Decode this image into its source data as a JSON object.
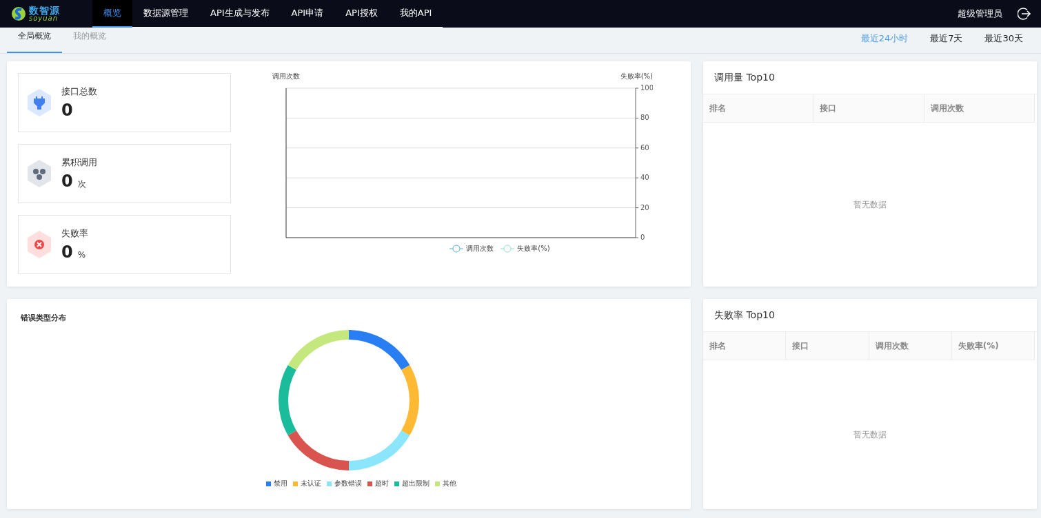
{
  "logo": {
    "name": "数智源",
    "sub": "soyuan"
  },
  "nav": [
    {
      "label": "概览",
      "selected": true
    },
    {
      "label": "数据源管理",
      "selected": false
    },
    {
      "label": "API生成与发布",
      "selected": false
    },
    {
      "label": "API申请",
      "selected": false
    },
    {
      "label": "API授权",
      "selected": false
    },
    {
      "label": "我的API",
      "selected": false
    }
  ],
  "user": "超级管理员",
  "subtabs": [
    {
      "label": "全局概览",
      "selected": true
    },
    {
      "label": "我的概览",
      "selected": false
    }
  ],
  "time_ranges": [
    {
      "label": "最近24小时",
      "selected": true
    },
    {
      "label": "最近7天",
      "selected": false
    },
    {
      "label": "最近30天",
      "selected": false
    }
  ],
  "stats": [
    {
      "kind": "interface",
      "label": "接口总数",
      "value": "0"
    },
    {
      "kind": "calls",
      "label": "累积调用",
      "value": "0",
      "unit": "次"
    },
    {
      "kind": "failure",
      "label": "失败率",
      "value": "0",
      "unit": "%"
    }
  ],
  "trend": {
    "left_axis_title": "调用次数",
    "right_axis_title": "失败率(%)",
    "chart_data": {
      "type": "line",
      "grid": true,
      "ylim": [
        0,
        100
      ],
      "yticks": [
        0,
        20,
        40,
        60,
        80,
        100
      ],
      "series": [
        {
          "name": "调用次数",
          "color": "#5ab1d8"
        },
        {
          "name": "失败率(%)",
          "color": "#8fdcd0"
        }
      ]
    }
  },
  "errors": {
    "title": "错误类型分布",
    "chart_data": {
      "type": "donut",
      "categories": [
        "禁用",
        "未认证",
        "参数错误",
        "超时",
        "超出限制",
        "其他"
      ],
      "series": [
        {
          "colors": [
            "#2a7ef4",
            "#ffb933",
            "#8be6fb",
            "#d9534f",
            "#1abc9c",
            "#c5e87e"
          ],
          "values": [
            16.67,
            16.67,
            16.66,
            16.67,
            16.67,
            16.66
          ]
        }
      ]
    }
  },
  "top_calls": {
    "title": "调用量 Top10",
    "columns": [
      "排名",
      "接口",
      "调用次数"
    ],
    "empty": "暂无数据"
  },
  "top_failures": {
    "title": "失败率 Top10",
    "columns": [
      "排名",
      "接口",
      "调用次数",
      "失败率(%)"
    ],
    "empty": "暂无数据"
  }
}
